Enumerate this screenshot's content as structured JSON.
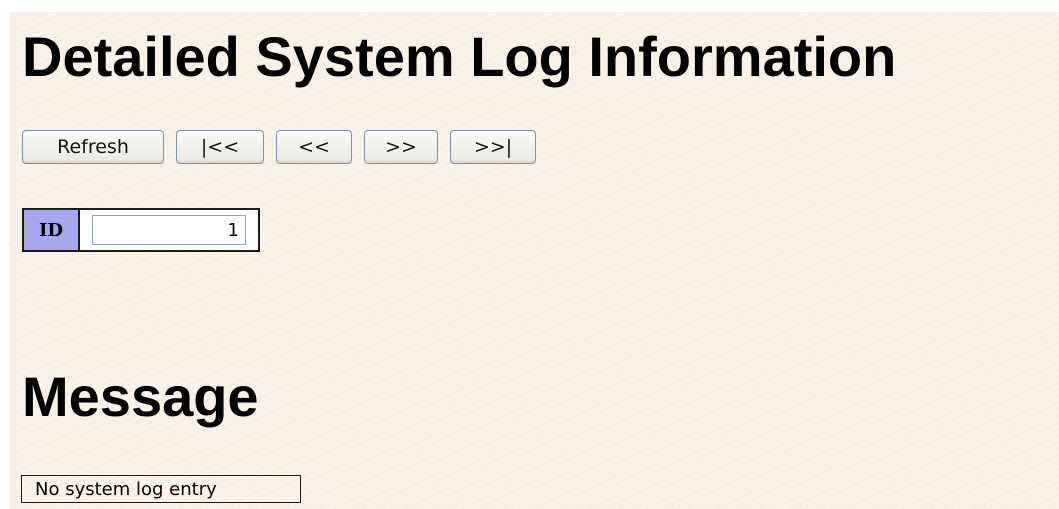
{
  "page": {
    "title": "Detailed System Log Information"
  },
  "toolbar": {
    "refresh_label": "Refresh",
    "first_label": "|<<",
    "prev_label": "<<",
    "next_label": ">>",
    "last_label": ">>|"
  },
  "id_field": {
    "label": "ID",
    "value": "1"
  },
  "message": {
    "heading": "Message",
    "text": "No system log entry"
  },
  "colors": {
    "background": "#f9f2e8",
    "id_label_bg": "#a7a7ee",
    "button_border": "#7d8ea6"
  }
}
